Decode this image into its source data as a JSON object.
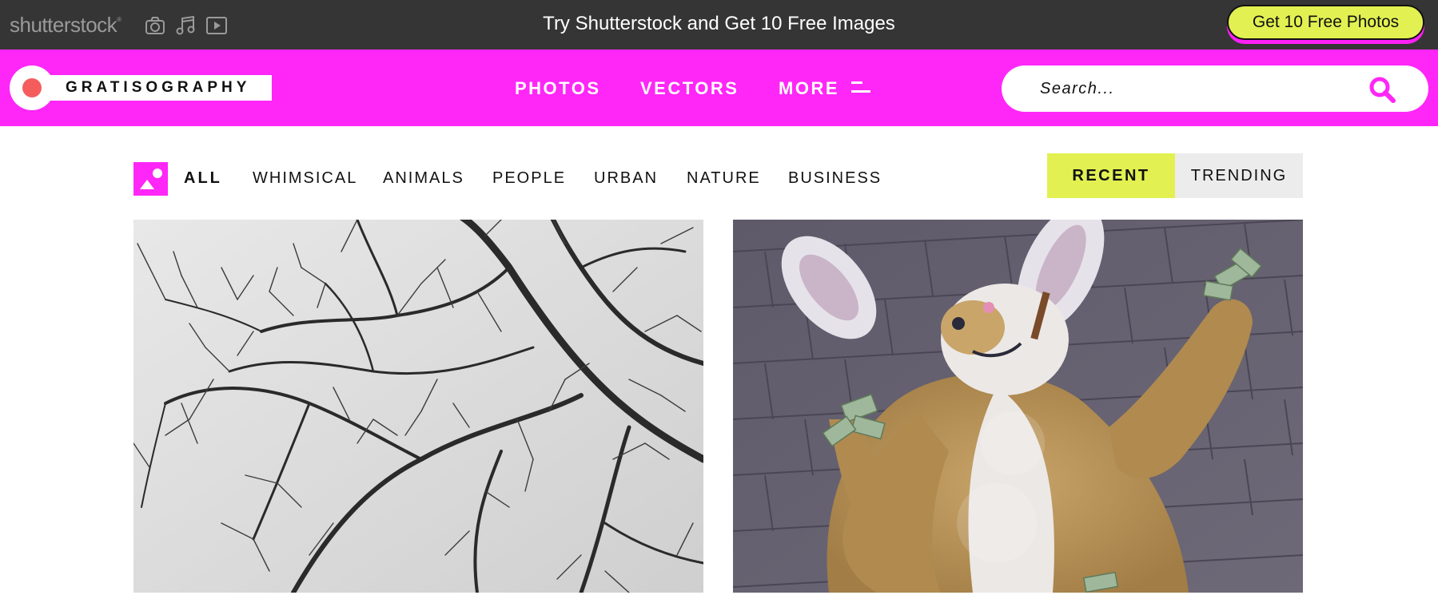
{
  "promo": {
    "brand": "shutterstock",
    "headline": "Try Shutterstock and Get 10 Free Images",
    "cta_label": "Get 10 Free Photos",
    "icons": [
      "camera-icon",
      "music-icon",
      "video-icon"
    ]
  },
  "header": {
    "logo_text": "GRATISOGRAPHY",
    "nav": [
      {
        "label": "PHOTOS"
      },
      {
        "label": "VECTORS"
      },
      {
        "label": "MORE"
      }
    ],
    "search": {
      "placeholder": "Search...",
      "value": ""
    }
  },
  "filters": {
    "categories": [
      "ALL",
      "WHIMSICAL",
      "ANIMALS",
      "PEOPLE",
      "URBAN",
      "NATURE",
      "BUSINESS"
    ],
    "active_category": "ALL",
    "sort": {
      "recent": "RECENT",
      "trending": "TRENDING",
      "active": "RECENT"
    }
  },
  "photos": [
    {
      "subject": "bare-tree-branches-photo"
    },
    {
      "subject": "bunny-costume-money-photo"
    }
  ],
  "colors": {
    "promo_bg": "#353535",
    "brand_pink": "#ff26f8",
    "accent_yellow": "#e2f151",
    "logo_dot": "#f55d5d",
    "trending_bg": "#ececec"
  }
}
